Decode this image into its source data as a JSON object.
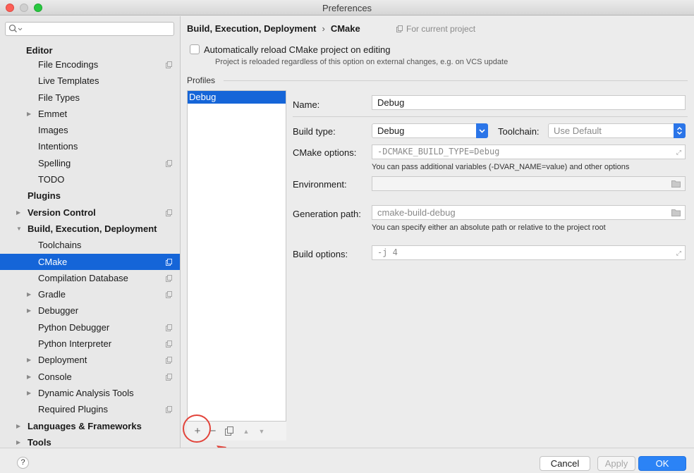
{
  "window": {
    "title": "Preferences"
  },
  "sidebar": {
    "search_placeholder": "",
    "items": [
      {
        "label": "Editor",
        "level": 0,
        "bold": true,
        "heading": true
      },
      {
        "label": "File Encodings",
        "level": 1,
        "copy": true
      },
      {
        "label": "Live Templates",
        "level": 1
      },
      {
        "label": "File Types",
        "level": 1
      },
      {
        "label": "Emmet",
        "level": 1,
        "arrow": true
      },
      {
        "label": "Images",
        "level": 1
      },
      {
        "label": "Intentions",
        "level": 1
      },
      {
        "label": "Spelling",
        "level": 1,
        "copy": true
      },
      {
        "label": "TODO",
        "level": 1
      },
      {
        "label": "Plugins",
        "level": 0,
        "bold": true
      },
      {
        "label": "Version Control",
        "level": 0,
        "bold": true,
        "arrow": true,
        "copy": true
      },
      {
        "label": "Build, Execution, Deployment",
        "level": 0,
        "bold": true,
        "arrow": true,
        "expanded": true
      },
      {
        "label": "Toolchains",
        "level": 1
      },
      {
        "label": "CMake",
        "level": 1,
        "copy": true,
        "selected": true
      },
      {
        "label": "Compilation Database",
        "level": 1,
        "copy": true
      },
      {
        "label": "Gradle",
        "level": 1,
        "arrow": true,
        "copy": true
      },
      {
        "label": "Debugger",
        "level": 1,
        "arrow": true
      },
      {
        "label": "Python Debugger",
        "level": 1,
        "copy": true
      },
      {
        "label": "Python Interpreter",
        "level": 1,
        "copy": true
      },
      {
        "label": "Deployment",
        "level": 1,
        "arrow": true,
        "copy": true
      },
      {
        "label": "Console",
        "level": 1,
        "arrow": true,
        "copy": true
      },
      {
        "label": "Dynamic Analysis Tools",
        "level": 1,
        "arrow": true
      },
      {
        "label": "Required Plugins",
        "level": 1,
        "copy": true
      },
      {
        "label": "Languages & Frameworks",
        "level": 0,
        "bold": true,
        "arrow": true
      },
      {
        "label": "Tools",
        "level": 0,
        "bold": true,
        "arrow": true
      }
    ]
  },
  "breadcrumb": {
    "parent": "Build, Execution, Deployment",
    "separator": "›",
    "current": "CMake"
  },
  "scope_label": "For current project",
  "auto_reload": {
    "checked": false,
    "label": "Automatically reload CMake project on editing",
    "hint": "Project is reloaded regardless of this option on external changes, e.g. on VCS update"
  },
  "profiles": {
    "label": "Profiles",
    "items": [
      "Debug"
    ],
    "selected": "Debug",
    "toolbar": {
      "add": "+",
      "remove": "−",
      "up": "▲",
      "down": "▼"
    }
  },
  "form": {
    "name_label": "Name:",
    "name_value": "Debug",
    "build_type_label": "Build type:",
    "build_type_value": "Debug",
    "toolchain_label": "Toolchain:",
    "toolchain_value": "Use Default",
    "cmake_options_label": "CMake options:",
    "cmake_options_value": "-DCMAKE_BUILD_TYPE=Debug",
    "cmake_options_hint": "You can pass additional variables (-DVAR_NAME=value) and other options",
    "environment_label": "Environment:",
    "environment_value": "",
    "generation_path_label": "Generation path:",
    "generation_path_value": "cmake-build-debug",
    "generation_path_hint": "You can specify either an absolute path or relative to the project root",
    "build_options_label": "Build options:",
    "build_options_value": "-j 4"
  },
  "footer": {
    "help": "?",
    "cancel": "Cancel",
    "apply": "Apply",
    "ok": "OK"
  },
  "colors": {
    "selection": "#1565d8",
    "accent": "#2b83f6",
    "annotation": "#e2443b"
  }
}
